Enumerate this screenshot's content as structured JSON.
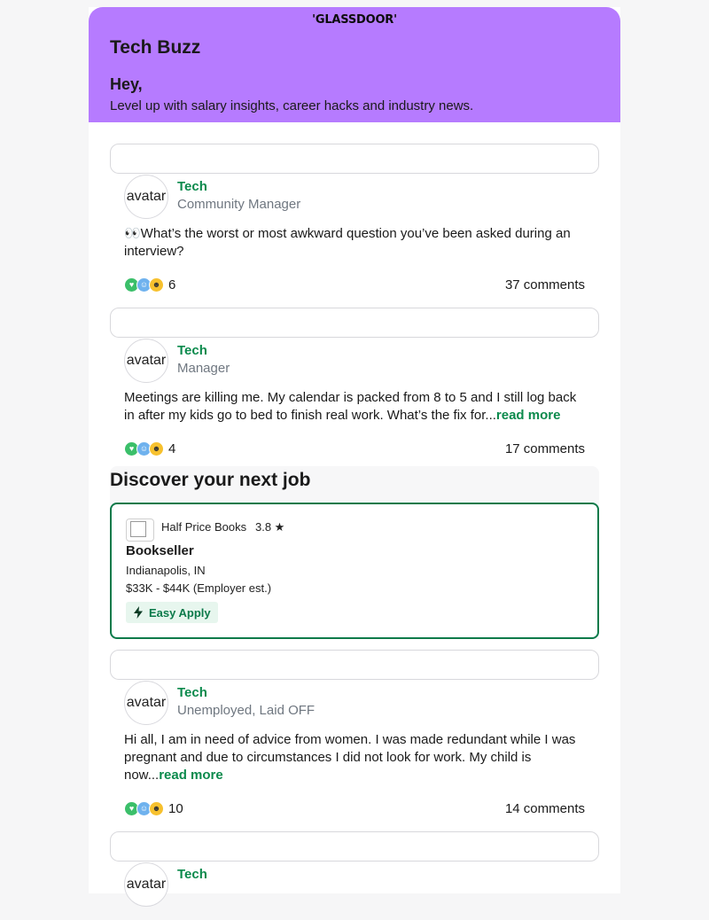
{
  "header": {
    "logo": "'GLASSDOOR'",
    "title": "Tech Buzz",
    "greeting": "Hey,",
    "tagline": "Level up with salary insights, career hacks and industry news.",
    "background_color": "#b67bff"
  },
  "posts": [
    {
      "avatar_alt": "avatar",
      "author": "Tech",
      "role": "Community Manager",
      "text": "👀What’s the worst or most awkward question you’ve been asked during an interview?",
      "read_more": "",
      "reactions": "6",
      "comments": "37 comments"
    },
    {
      "avatar_alt": "avatar",
      "author": "Tech",
      "role": "Manager",
      "text": "Meetings are killing me. My calendar is packed from 8 to 5 and I still log back in after my kids go to bed to finish real work. What’s the fix for...",
      "read_more": "read more",
      "reactions": "4",
      "comments": "17 comments"
    },
    {
      "avatar_alt": "avatar",
      "author": "Tech",
      "role": "Unemployed, Laid OFF",
      "text": "Hi all, I am in need of advice from women. I was made redundant while I was pregnant and due to circumstances I did not look for work. My child is now...",
      "read_more": "read more",
      "reactions": "10",
      "comments": "14 comments"
    },
    {
      "avatar_alt": "avatar",
      "author": "Tech"
    }
  ],
  "jobs": {
    "section_title": "Discover your next job",
    "card": {
      "company": "Half Price Books",
      "rating": "3.8 ★",
      "title": "Bookseller",
      "location": "Indianapolis, IN",
      "salary": "$33K - $44K (Employer est.)",
      "easy_apply": "Easy Apply"
    }
  },
  "colors": {
    "accent_green": "#0b8a4c",
    "card_border": "#0b7a4a"
  }
}
